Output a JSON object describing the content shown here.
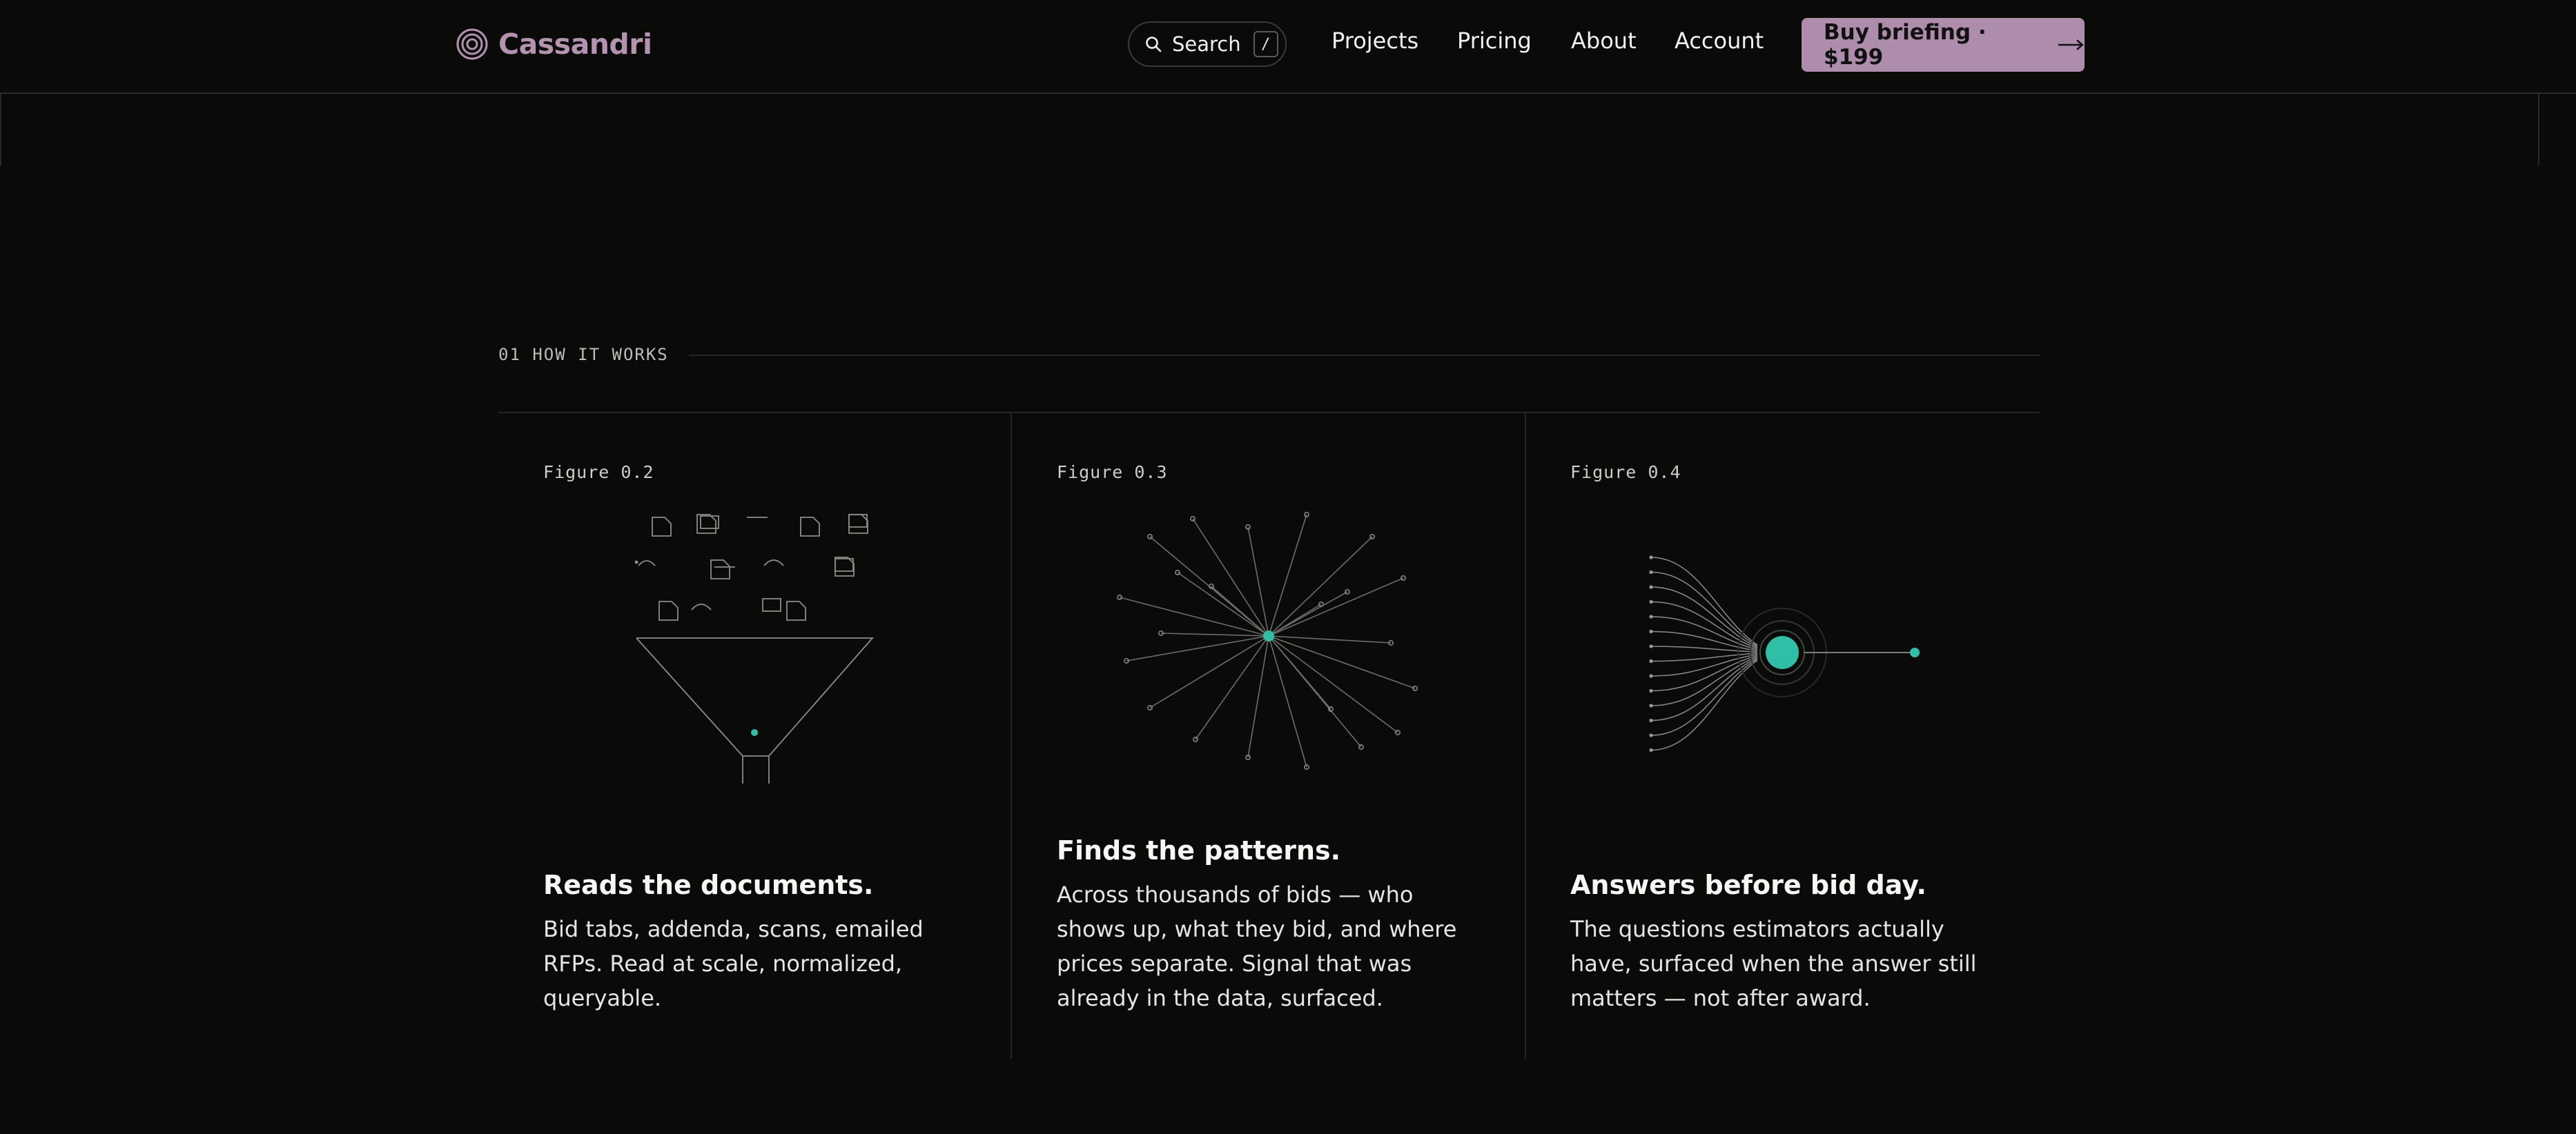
{
  "brand": {
    "name": "Cassandri",
    "icon": "concentric-circles-logo-icon",
    "color": "#b493b1"
  },
  "search": {
    "label": "Search",
    "shortcut": "/",
    "icon": "search-icon"
  },
  "nav": {
    "items": [
      {
        "label": "Projects"
      },
      {
        "label": "Pricing"
      },
      {
        "label": "About"
      },
      {
        "label": "Account"
      }
    ]
  },
  "cta": {
    "label": "Buy briefing · $199",
    "icon": "arrow-right-icon",
    "color": "#ad8dab"
  },
  "section": {
    "label": "01 HOW IT WORKS"
  },
  "accent_color": "#2fbfa6",
  "cards": [
    {
      "figure": "Figure 0.2",
      "title": "Reads the documents.",
      "body": "Bid tabs, addenda, scans, emailed RFPs. Read at scale, normalized, queryable.",
      "illustration": "funnel-illustration"
    },
    {
      "figure": "Figure 0.3",
      "title": "Finds the patterns.",
      "body": "Across thousands of bids — who shows up, what they bid, and where prices separate. Signal that was already in the data, surfaced.",
      "illustration": "radial-network-illustration"
    },
    {
      "figure": "Figure 0.4",
      "title": "Answers before bid day.",
      "body": "The questions estimators actually have, surfaced when the answer still matters — not after award.",
      "illustration": "convergence-illustration"
    }
  ]
}
